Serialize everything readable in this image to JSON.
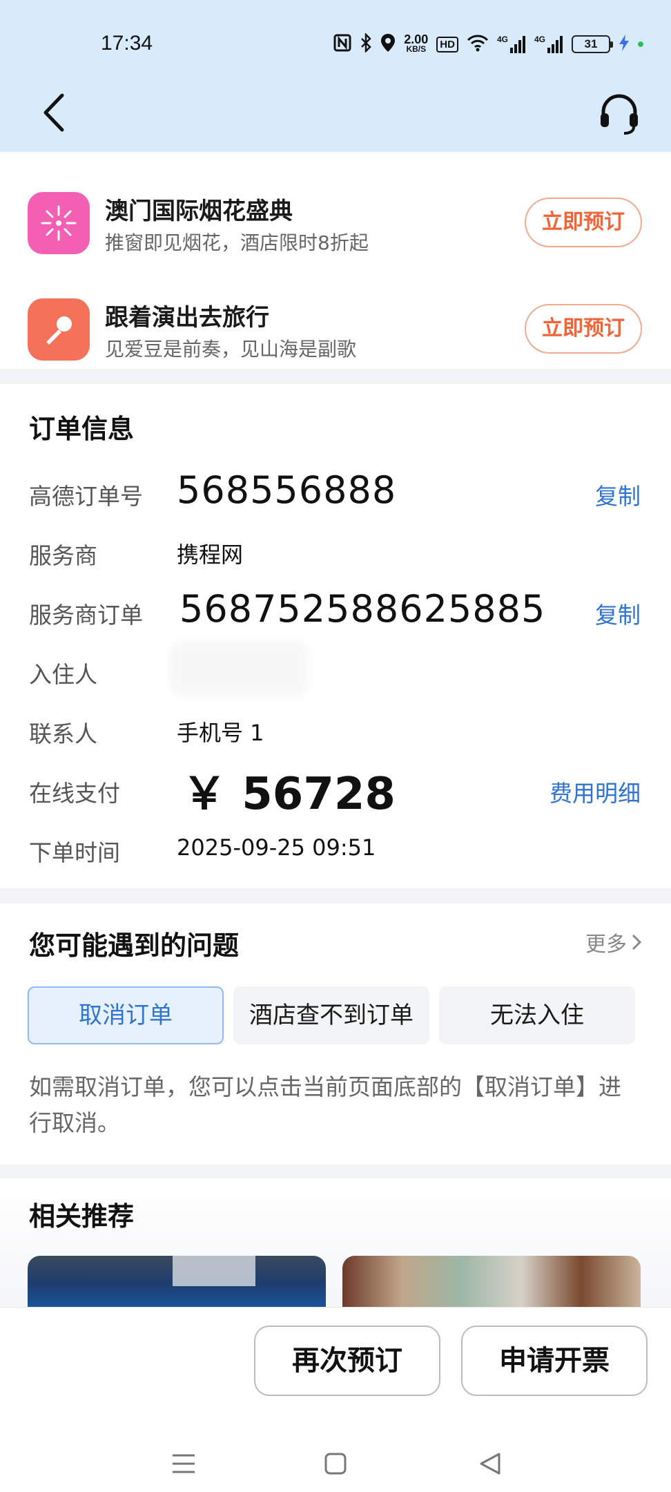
{
  "status_bar": {
    "time": "17:34",
    "net_speed_value": "2.00",
    "net_speed_unit": "KB/S",
    "hd_label": "HD",
    "signal1_label": "4G",
    "signal2_label": "4G",
    "battery_level": "31"
  },
  "promos": [
    {
      "title": "澳门国际烟花盛典",
      "subtitle": "推窗即见烟花，酒店限时8折起",
      "button": "立即预订",
      "icon": "fireworks-icon",
      "color": "#f25fb3"
    },
    {
      "title": "跟着演出去旅行",
      "subtitle": "见爱豆是前奏，见山海是副歌",
      "button": "立即预订",
      "icon": "microphone-icon",
      "color": "#f47259"
    }
  ],
  "order": {
    "title": "订单信息",
    "rows": [
      {
        "label": "高德订单号",
        "value": "568556888",
        "action": "复制"
      },
      {
        "label": "服务商",
        "value": "携程网"
      },
      {
        "label": "服务商订单",
        "value": "568752588625885",
        "action": "复制"
      },
      {
        "label": "入住人",
        "value": ""
      },
      {
        "label": "联系人",
        "value": "手机号 1"
      },
      {
        "label": "在线支付",
        "value": "￥ 56728",
        "action": "费用明细"
      },
      {
        "label": "下单时间",
        "value": "2025-09-25 09:51"
      }
    ]
  },
  "faq": {
    "title": "您可能遇到的问题",
    "more": "更多",
    "chips": [
      "取消订单",
      "酒店查不到订单",
      "无法入住"
    ],
    "active_chip": "取消订单",
    "answer": "如需取消订单，您可以点击当前页面底部的【取消订单】进行取消。"
  },
  "recommend": {
    "title": "相关推荐"
  },
  "bottom_bar": {
    "rebook": "再次预订",
    "invoice": "申请开票"
  },
  "colors": {
    "header_bg": "#d9ebfb",
    "link_blue": "#2f74d0",
    "accent_orange": "#f0643a"
  }
}
